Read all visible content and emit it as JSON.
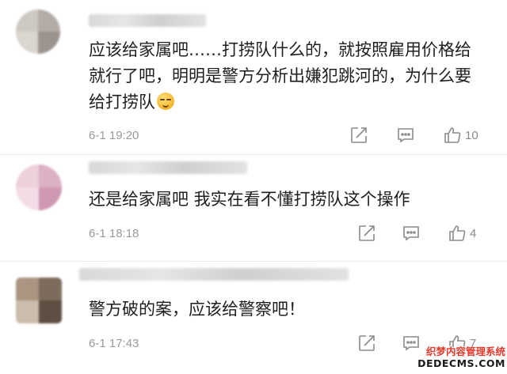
{
  "comments": [
    {
      "text": "应该给家属吧……打捞队什么的，就按照雇用价格给就行了吧，明明是警方分析出嫌犯跳河的，为什么要给打捞队",
      "emoji": "smirk-emoji",
      "timestamp": "6-1 19:20",
      "likes": "10",
      "avatar_colors": [
        "#c9c3bf",
        "#a9a29d",
        "#d7d1cc",
        "#8e8884"
      ]
    },
    {
      "text": "还是给家属吧 我实在看不懂打捞队这个操作",
      "timestamp": "6-1 18:18",
      "likes": "4",
      "avatar_colors": [
        "#e7c7d4",
        "#d9a9bf",
        "#f0d9e2",
        "#c98fab"
      ]
    },
    {
      "text": "警方破的案，应该给警察吧！",
      "timestamp": "6-1 17:43",
      "likes": "7",
      "avatar_colors": [
        "#a08a74",
        "#7b6a5a",
        "#c8b9a8",
        "#5f5044"
      ]
    }
  ],
  "icons": {
    "share": "share-icon",
    "reply": "comment-icon",
    "like": "thumbs-up-icon"
  },
  "watermark": {
    "line1": "织梦内容管理系统",
    "line2": "DEDECMS.COM"
  }
}
